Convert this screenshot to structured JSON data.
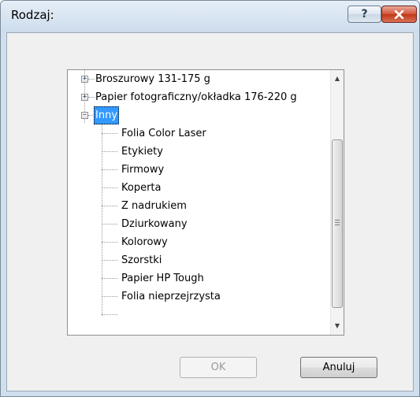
{
  "window": {
    "title": "Rodzaj:",
    "help_glyph": "?",
    "close_icon": "close-x-icon"
  },
  "tree": {
    "items": [
      {
        "label": "Broszurowy 131-175 g",
        "expander": "+"
      },
      {
        "label": "Papier fotograficzny/okładka 176-220 g",
        "expander": "+"
      },
      {
        "label": "Inny",
        "expander": "−",
        "selected": true
      },
      {
        "label": "Folia Color Laser"
      },
      {
        "label": "Etykiety"
      },
      {
        "label": "Firmowy"
      },
      {
        "label": "Koperta"
      },
      {
        "label": "Z nadrukiem"
      },
      {
        "label": "Dziurkowany"
      },
      {
        "label": "Kolorowy"
      },
      {
        "label": "Szorstki"
      },
      {
        "label": "Papier HP Tough"
      },
      {
        "label": "Folia nieprzejrzysta"
      }
    ],
    "scroll_up_glyph": "▲",
    "scroll_down_glyph": "▼"
  },
  "buttons": {
    "ok_label": "OK",
    "cancel_label": "Anuluj"
  },
  "colors": {
    "selection": "#3399ff",
    "close_button": "#c03716"
  }
}
